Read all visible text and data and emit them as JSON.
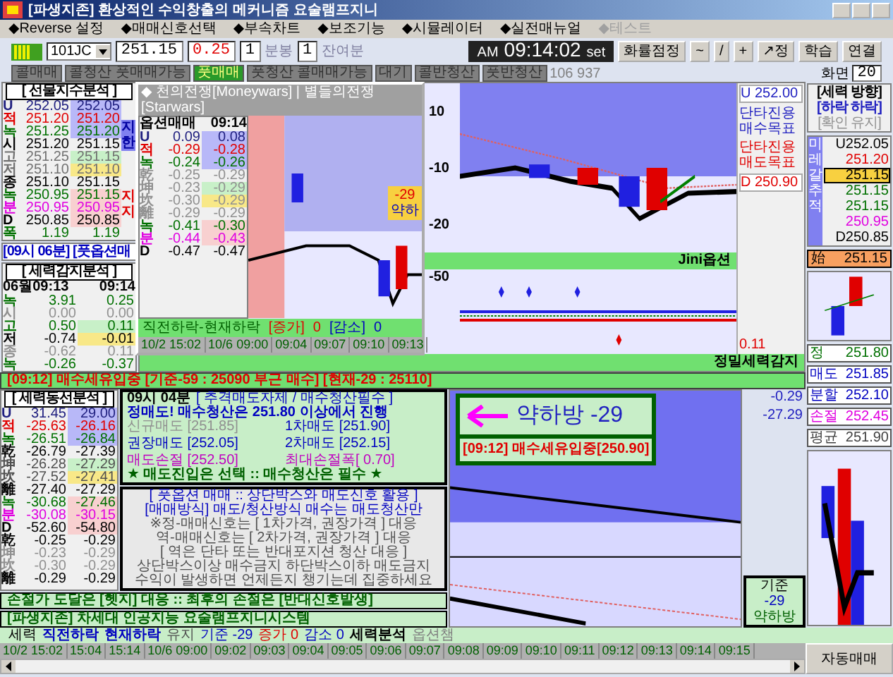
{
  "window": {
    "title": "[파생지존] 환상적인 수익창출의 메커니즘 요술램프지니"
  },
  "menu": [
    {
      "label": "◆Reverse 설정",
      "disabled": false
    },
    {
      "label": "◆매매신호선택",
      "disabled": false
    },
    {
      "label": "◆부속차트",
      "disabled": false
    },
    {
      "label": "◆보조기능",
      "disabled": false
    },
    {
      "label": "◆시뮬레이터",
      "disabled": false
    },
    {
      "label": "◆실전매뉴얼",
      "disabled": false
    },
    {
      "label": "◆테스트",
      "disabled": true
    }
  ],
  "toolbar": {
    "symbol": "101JC",
    "price": "251.15",
    "change": "0.25",
    "interval": "1",
    "interval_unit": "분봉",
    "remaining": "1",
    "remaining_unit": "잔여분",
    "clock": {
      "ampm": "AM",
      "time": "09:14:02",
      "set": "set"
    },
    "buttons": [
      "화률점정",
      "~",
      "/",
      "+",
      "↗정",
      "학습",
      "연결"
    ]
  },
  "signals": [
    {
      "label": "콜매매",
      "selected": false
    },
    {
      "label": "콜청산 풋매매가능",
      "selected": false
    },
    {
      "label": "풋매매",
      "selected": true
    },
    {
      "label": "풋청산 콜매매가능",
      "selected": false
    },
    {
      "label": "대기",
      "selected": false
    },
    {
      "label": "콜반청산",
      "selected": false
    },
    {
      "label": "풋반청산",
      "selected": false
    }
  ],
  "volume": "106 937",
  "screen": {
    "label": "화면",
    "value": "20"
  },
  "futures_panel": {
    "title": "[ 선물지수분석 ]",
    "side": [
      "지한",
      "지지"
    ],
    "rows": [
      {
        "label": "U",
        "a": "252.05",
        "b": "252.05",
        "color": "#202080",
        "kind": "upper"
      },
      {
        "label": "적",
        "a": "251.20",
        "b": "251.20",
        "color": "#e00000",
        "kind": "upper"
      },
      {
        "label": "녹",
        "a": "251.25",
        "b": "251.20",
        "color": "#007000",
        "kind": "upper"
      },
      {
        "label": "시",
        "a": "251.20",
        "b": "251.15",
        "color": "#000000",
        "kind": "plain"
      },
      {
        "label": "고",
        "a": "251.25",
        "b": "251.15",
        "color": "#707070",
        "kind": "high"
      },
      {
        "label": "저",
        "a": "251.10",
        "b": "251.10",
        "color": "#707070",
        "kind": "low"
      },
      {
        "label": "종",
        "a": "251.10",
        "b": "251.15",
        "color": "#000000",
        "kind": "plain"
      },
      {
        "label": "녹",
        "a": "250.95",
        "b": "251.15",
        "color": "#007000",
        "kind": "lower"
      },
      {
        "label": "분",
        "a": "250.95",
        "b": "250.95",
        "color": "#e000e0",
        "kind": "lower"
      },
      {
        "label": "D",
        "a": "250.85",
        "b": "250.85",
        "color": "#000000",
        "kind": "lower"
      },
      {
        "label": "폭",
        "a": "1.19",
        "b": "1.19",
        "color": "#007000",
        "kind": "plain"
      }
    ]
  },
  "time_note": "[09시 06분] [풋옵션매",
  "force_panel": {
    "title": "[ 세력감지분석 ]",
    "head": [
      "06월09:13",
      "09:14"
    ],
    "rows": [
      {
        "label": "녹",
        "a": "3.91",
        "b": "0.25",
        "color": "#007000",
        "kind": "plain"
      },
      {
        "label": "시",
        "a": "0.00",
        "b": "0.00",
        "color": "#909090",
        "kind": "plain"
      },
      {
        "label": "고",
        "a": "0.50",
        "b": "0.11",
        "color": "#007000",
        "kind": "high"
      },
      {
        "label": "저",
        "a": "-0.74",
        "b": "-0.01",
        "color": "#000000",
        "kind": "low"
      },
      {
        "label": "종",
        "a": "-0.62",
        "b": "0.11",
        "color": "#909090",
        "kind": "plain"
      },
      {
        "label": "녹",
        "a": "-0.26",
        "b": "-0.37",
        "color": "#007000",
        "kind": "plain"
      }
    ]
  },
  "popup": {
    "title": "◆ 천의전쟁[Moneywars] | 별들의전쟁[Starwars]",
    "head": [
      "옵션매매",
      "09:14"
    ],
    "rows": [
      {
        "label": "U",
        "a": "0.09",
        "b": "0.08",
        "color": "#202080",
        "kind": "upper"
      },
      {
        "label": "적",
        "a": "-0.29",
        "b": "-0.28",
        "color": "#e00000",
        "kind": "upper"
      },
      {
        "label": "녹",
        "a": "-0.24",
        "b": "-0.26",
        "color": "#007000",
        "kind": "upper"
      },
      {
        "label": "乾",
        "a": "-0.25",
        "b": "-0.29",
        "color": "#909090",
        "kind": "plain"
      },
      {
        "label": "坤",
        "a": "-0.23",
        "b": "-0.29",
        "color": "#909090",
        "kind": "high"
      },
      {
        "label": "坎",
        "a": "-0.30",
        "b": "-0.29",
        "color": "#909090",
        "kind": "low"
      },
      {
        "label": "離",
        "a": "-0.29",
        "b": "-0.29",
        "color": "#909090",
        "kind": "plain"
      },
      {
        "label": "녹",
        "a": "-0.41",
        "b": "-0.30",
        "color": "#007000",
        "kind": "lower"
      },
      {
        "label": "분",
        "a": "-0.44",
        "b": "-0.43",
        "color": "#e000e0",
        "kind": "lower"
      },
      {
        "label": "D",
        "a": "-0.47",
        "b": "-0.47",
        "color": "#000000",
        "kind": "plain"
      }
    ],
    "footer": [
      "직전하락-현재하락",
      "[증가]",
      "0",
      "[감소]",
      "0"
    ],
    "times": [
      "10/2 15:02",
      "10/6 09:00",
      "09:04",
      "09:07",
      "09:10",
      "09:13"
    ]
  },
  "main_chart": {
    "axis": [
      "10",
      "-10",
      "-20",
      "-50"
    ],
    "badge": [
      "-29",
      "약하"
    ],
    "labels": [
      {
        "kind": "value",
        "text": "U 252.00",
        "color": "#2020c0"
      },
      {
        "kind": "note",
        "text": "단타진용 매수목표",
        "color": "#2020c0"
      },
      {
        "kind": "note",
        "text": "단타진용 매도목표",
        "color": "#e00000"
      },
      {
        "kind": "value",
        "text": "D 250.90",
        "color": "#e00000"
      }
    ],
    "legend": "Jini옵션",
    "reading": "0.11",
    "strip": "정밀세력감지"
  },
  "banner": "[09:12] 매수세유입중 [기준-59 : 25090 부근 매수] [현재-29 : 25110]",
  "direction": {
    "title": "[세력 방향]",
    "state": "[하락 하락]",
    "confirm": "[확인 유지]",
    "track": "미레갈추적",
    "values": [
      {
        "text": "U252.05",
        "color": "#000000",
        "selected": false
      },
      {
        "text": "251.20",
        "color": "#e00000",
        "selected": false
      },
      {
        "text": "251.15",
        "color": "#000000",
        "selected": true
      },
      {
        "text": "251.15",
        "color": "#007000",
        "selected": false
      },
      {
        "text": "251.15",
        "color": "#007000",
        "selected": false
      },
      {
        "text": "250.95",
        "color": "#e000e0",
        "selected": false
      },
      {
        "text": "D250.85",
        "color": "#000000",
        "selected": false
      }
    ],
    "current": [
      "始",
      "251.15"
    ]
  },
  "line_panel": {
    "title": "[ 세력동선분석 ]",
    "rows": [
      {
        "label": "U",
        "a": "31.45",
        "b": "29.00",
        "color": "#202080",
        "kind": "upper"
      },
      {
        "label": "적",
        "a": "-25.63",
        "b": "-26.16",
        "color": "#e00000",
        "kind": "upper"
      },
      {
        "label": "녹",
        "a": "-26.51",
        "b": "-26.84",
        "color": "#007000",
        "kind": "upper"
      },
      {
        "label": "乾",
        "a": "-26.79",
        "b": "-27.39",
        "color": "#000000",
        "kind": "plain"
      },
      {
        "label": "坤",
        "a": "-26.28",
        "b": "-27.29",
        "color": "#505050",
        "kind": "high"
      },
      {
        "label": "坎",
        "a": "-27.52",
        "b": "-27.41",
        "color": "#505050",
        "kind": "low"
      },
      {
        "label": "離",
        "a": "-27.40",
        "b": "-27.29",
        "color": "#000000",
        "kind": "plain"
      },
      {
        "label": "녹",
        "a": "-30.68",
        "b": "-27.46",
        "color": "#007000",
        "kind": "lower"
      },
      {
        "label": "분",
        "a": "-30.08",
        "b": "-30.15",
        "color": "#e000e0",
        "kind": "lower"
      },
      {
        "label": "D",
        "a": "-52.60",
        "b": "-54.80",
        "color": "#000000",
        "kind": "lower"
      },
      {
        "label": "乾",
        "a": "-0.25",
        "b": "-0.29",
        "color": "#000000",
        "kind": "plain"
      },
      {
        "label": "坤",
        "a": "-0.23",
        "b": "-0.29",
        "color": "#909090",
        "kind": "plain"
      },
      {
        "label": "坎",
        "a": "-0.30",
        "b": "-0.29",
        "color": "#909090",
        "kind": "plain"
      },
      {
        "label": "離",
        "a": "-0.29",
        "b": "-0.29",
        "color": "#000000",
        "kind": "plain"
      }
    ]
  },
  "strategy": {
    "time": "09시 04분",
    "headline": "[ 추격매도자제 / 매수청산필수 ]",
    "lead": "정매도! 매수청산은 251.80 이상에서 진행",
    "prices": [
      {
        "text": "신규매도 [251.85]",
        "color": "#909090"
      },
      {
        "text": "1차매도 [251.90]",
        "color": "#0000c0"
      },
      {
        "text": "권장매도 [252.05]",
        "color": "#0000c0"
      },
      {
        "text": "2차매도 [252.15]",
        "color": "#0000c0"
      },
      {
        "text": "매도손절 [252.50]",
        "color": "#c000c0"
      },
      {
        "text": "최대손절폭[ 0.70]",
        "color": "#c000c0"
      }
    ],
    "footer": "★ 매도진입은 선택 :: 매수청산은 필수 ★"
  },
  "guide": [
    "[ 풋옵션 매매 :: 상단박스와 매도신호 활용 ]",
    "[매매방식] 매도/청산방식 매수는 매도청산만",
    "※정-매매신호는 [ 1차가격, 권장가격 ] 대응",
    "역-매매신호는 [ 2차가격, 권장가격 ] 대응",
    "[ 역은 단타 또는 반대포지션 청산 대응 ]",
    "상단박스이상 매수금지  하단박스이하 매도금지",
    "수익이 발생하면 언제든지 챙기는데 집중하세요"
  ],
  "notices": [
    "손절가 도달은 [헷지] 대응 :: 최후의 손절은 [반대신호발생]",
    "[파생지존] 차세대 인공지능 요술램프지니시스템"
  ],
  "signal_box": {
    "text": "약하방 -29",
    "note": "[09:12] 매수세유입중[250.90]"
  },
  "lower_readings": [
    "-0.29",
    "-27.29"
  ],
  "base_box": [
    "기준",
    "-29",
    "약하방"
  ],
  "orders": [
    {
      "label": "정",
      "value": "251.80",
      "color": "#007000"
    },
    {
      "label": "매도",
      "value": "251.85",
      "color": "#0000c0"
    },
    {
      "label": "분할",
      "value": "252.10",
      "color": "#0000c0"
    },
    {
      "label": "손절",
      "value": "252.45",
      "color": "#e000e0"
    },
    {
      "label": "평균",
      "value": "251.90",
      "color": "#404040"
    }
  ],
  "status": [
    "세력",
    "직전하락",
    "현재하락",
    "유지",
    "기준 -29",
    "증가 0",
    "감소 0",
    "세력분석",
    "옵션챔"
  ],
  "times": [
    "10/2 15:02",
    "15:04",
    "15:14",
    "10/6 09:00",
    "09:02",
    "09:03",
    "09:04",
    "09:05",
    "09:06",
    "09:07",
    "09:08",
    "09:09",
    "09:10",
    "09:11",
    "09:12",
    "09:13",
    "09:14",
    "09:15"
  ],
  "auto_button": "자동매매"
}
